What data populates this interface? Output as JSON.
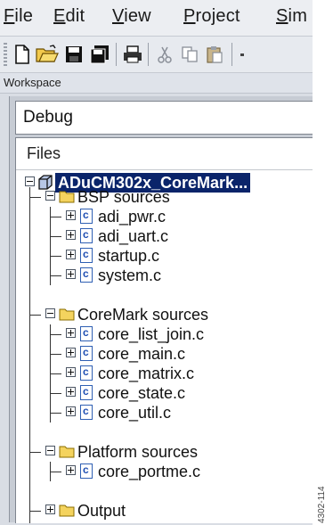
{
  "menu": {
    "items": [
      {
        "pre": "",
        "u": "F",
        "post": "ile"
      },
      {
        "pre": "",
        "u": "E",
        "post": "dit"
      },
      {
        "pre": "",
        "u": "V",
        "post": "iew"
      },
      {
        "pre": "",
        "u": "P",
        "post": "roject"
      },
      {
        "pre": "",
        "u": "S",
        "post": "im"
      }
    ]
  },
  "toolbar": {
    "icons": [
      "new-file-icon",
      "open-folder-icon",
      "save-icon",
      "save-all-icon",
      "print-icon",
      "cut-icon",
      "copy-icon",
      "paste-icon"
    ]
  },
  "workspace": {
    "title": "Workspace",
    "config": "Debug",
    "files_header": "Files"
  },
  "tree": {
    "project": "ADuCM302x_CoreMark...",
    "groups": [
      {
        "name": "BSP sources",
        "files": [
          "adi_pwr.c",
          "adi_uart.c",
          "startup.c",
          "system.c"
        ]
      },
      {
        "name": "CoreMark sources",
        "files": [
          "core_list_join.c",
          "core_main.c",
          "core_matrix.c",
          "core_state.c",
          "core_util.c"
        ]
      },
      {
        "name": "Platform sources",
        "files": [
          "core_portme.c"
        ]
      },
      {
        "name": "Output",
        "files": []
      }
    ]
  },
  "figure_id": "4302-114",
  "colors": {
    "selection": "#0a246a",
    "folder": "#f4d35e",
    "file_icon": "#2f5fb3"
  }
}
